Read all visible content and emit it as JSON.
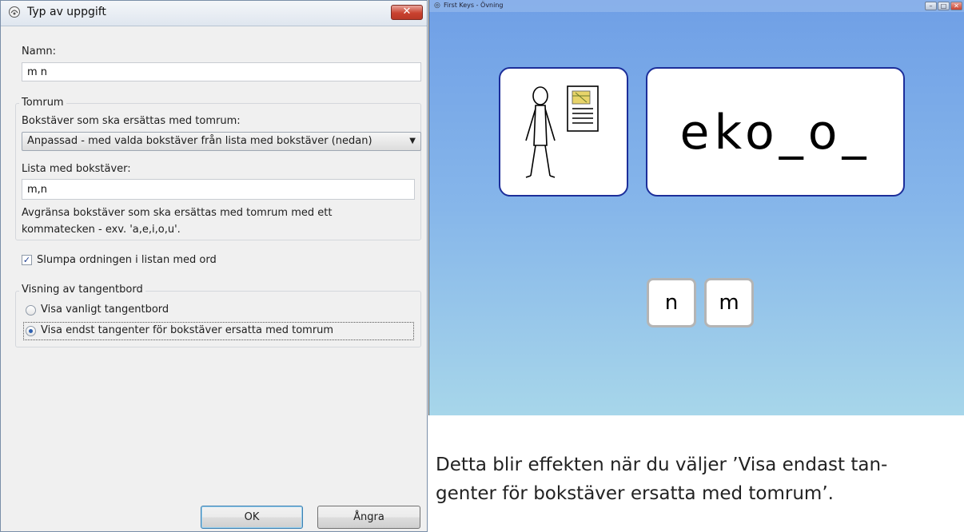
{
  "dialog": {
    "title": "Typ av uppgift",
    "close_label": "✕",
    "name_label": "Namn:",
    "name_value": "m n",
    "blank_group": {
      "legend": "Tomrum",
      "letters_label": "Bokstäver som ska ersättas med tomrum:",
      "selected_option": "Anpassad - med valda bokstäver från lista med bokstäver (nedan)",
      "list_label": "Lista med bokstäver:",
      "list_value": "m,n",
      "hint_line1": "Avgränsa bokstäver som ska ersättas med tomrum med ett",
      "hint_line2": "kommatecken - exv. 'a,e,i,o,u'."
    },
    "shuffle": {
      "label": "Slumpa ordningen i listan med ord",
      "checked": true
    },
    "keyboard_group": {
      "legend": "Visning av tangentbord",
      "options": [
        {
          "label": "Visa vanligt tangentbord",
          "selected": false
        },
        {
          "label": "Visa endst tangenter för bokstäver ersatta med tomrum",
          "selected": true
        }
      ]
    },
    "ok_label": "OK",
    "cancel_label": "Ångra"
  },
  "app": {
    "title": "First Keys - Övning",
    "word": "eko_o_",
    "keys": [
      "n",
      "m"
    ],
    "background_top": "#6f9fe6",
    "background_bottom": "#a7d6ea",
    "card_border": "#1c2e9a"
  },
  "caption": {
    "line1": "Detta blir effekten när du väljer ’Visa endast tan-",
    "line2": "genter för bokstäver ersatta med tomrum’."
  }
}
